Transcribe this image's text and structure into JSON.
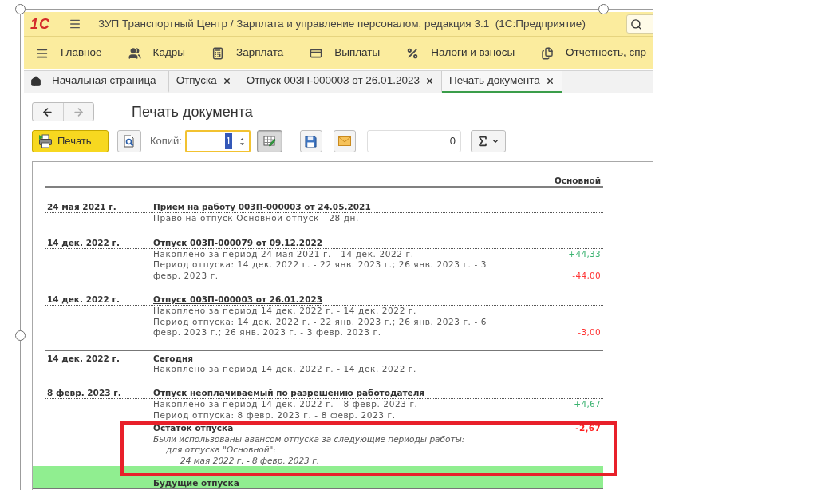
{
  "window": {
    "logo": "1С",
    "title": "ЗУП Транспортный Центр / Зарплата и управление персоналом, редакция 3.1  (1С:Предприятие)"
  },
  "sections": [
    {
      "label": "Главное"
    },
    {
      "label": "Кадры"
    },
    {
      "label": "Зарплата"
    },
    {
      "label": "Выплаты"
    },
    {
      "label": "Налоги и взносы"
    },
    {
      "label": "Отчетность, спр"
    }
  ],
  "tabs": [
    {
      "kind": "home",
      "label": "Начальная страница",
      "selected": false
    },
    {
      "kind": "document",
      "label": "Отпуска",
      "selected": false
    },
    {
      "kind": "document",
      "label": "Отпуск 003П-000003 от 26.01.2023",
      "selected": false
    },
    {
      "kind": "document",
      "label": "Печать документа",
      "selected": true
    }
  ],
  "navigation": [
    {
      "kind": "back",
      "disabled": false
    },
    {
      "kind": "forward",
      "disabled": true
    }
  ],
  "form": {
    "title": "Печать документа"
  },
  "toolbar": {
    "print_label": "Печать",
    "copies_label": "Копий:",
    "copies_value": "1",
    "copies_focused": true,
    "edit_mode_pressed": true,
    "sum_value": "0"
  },
  "report": {
    "column_header": "Основной",
    "entries": [
      {
        "kind": "document",
        "date": "24 мая 2021 г.",
        "title": "Прием на работу 003П-000003 от 24.05.2021",
        "lines": [
          {
            "kind": "plain",
            "text": "Право на отпуск Основной отпуск - 28 дн."
          }
        ]
      },
      {
        "kind": "document",
        "date": "14 дек. 2022 г.",
        "title": "Отпуск 003П-000079 от 09.12.2022",
        "lines": [
          {
            "kind": "plain",
            "text": "Накоплено за период 24 мая 2021 г. - 14 дек. 2022 г.",
            "amount": "+44,33",
            "color": "#3cb371"
          },
          {
            "kind": "plain",
            "text": "Период отпуска: 14 дек. 2022 г. - 22 янв. 2023 г.; 26 янв. 2023 г. - 3 февр. 2023 г.",
            "amount": "-44,00",
            "color": "#ff3333"
          }
        ]
      },
      {
        "kind": "document",
        "date": "14 дек. 2022 г.",
        "title": "Отпуск 003П-000003 от 26.01.2023",
        "lines": [
          {
            "kind": "plain",
            "text": "Накоплено за период 14 дек. 2022 г. - 14 дек. 2022 г."
          },
          {
            "kind": "plain",
            "text": "Период отпуска: 14 дек. 2022 г. - 22 янв. 2023 г.; 26 янв. 2023 г. - 6 февр. 2023 г.; 26 янв. 2023 г. - 3 февр. 2023 г.",
            "amount": "-3,00",
            "color": "#ff3333"
          }
        ]
      },
      {
        "kind": "today",
        "date": "14 дек. 2022 г.",
        "title": "Сегодня",
        "lines": [
          {
            "kind": "plain",
            "text": "Накоплено за период 14 дек. 2022 г. - 14 дек. 2022 г."
          }
        ]
      },
      {
        "kind": "plan",
        "date": "8 февр. 2023 г.",
        "title": "Отпуск неоплачиваемый по разрешению работодателя",
        "lines": [
          {
            "kind": "plain",
            "text": "Накоплено за период 14 дек. 2022 г. - 8 февр. 2023 г.",
            "amount": "+4,67",
            "color": "#3cb371"
          },
          {
            "kind": "plain",
            "text": "Период отпуска: 8 февр. 2023 г. - 8 февр. 2023 г."
          },
          {
            "kind": "balance",
            "text": "Остаток отпуска",
            "amount": "-2,67",
            "color": "#ff2020",
            "notes": [
              {
                "text": "Были использованы авансом отпуска за следующие периоды работы:",
                "children": [
                  {
                    "text": "для отпуска \"Основной\":",
                    "children": [
                      {
                        "text": "24 мая 2022 г. - 8 февр. 2023 г."
                      }
                    ]
                  }
                ]
              }
            ]
          }
        ]
      }
    ],
    "band": {
      "label": "Будущие отпуска"
    }
  }
}
